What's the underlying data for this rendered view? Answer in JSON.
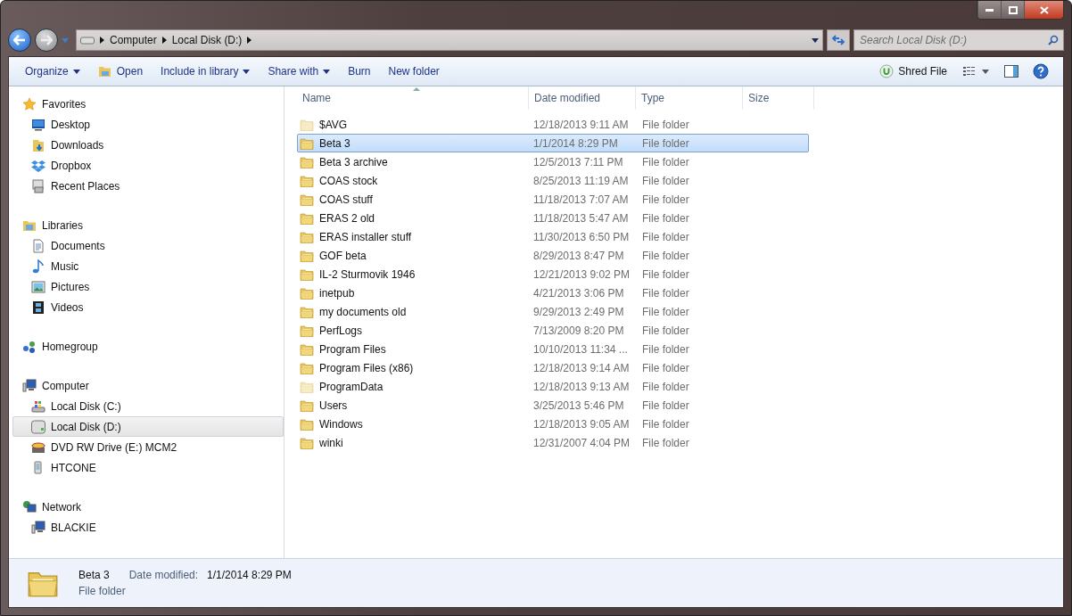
{
  "address": {
    "crumbs": [
      "Computer",
      "Local Disk (D:)"
    ]
  },
  "search": {
    "placeholder": "Search Local Disk (D:)"
  },
  "toolbar": {
    "left": [
      {
        "label": "Organize",
        "kind": "menu"
      },
      {
        "label": "Open",
        "kind": "open"
      },
      {
        "label": "Include in library",
        "kind": "menu"
      },
      {
        "label": "Share with",
        "kind": "menu"
      },
      {
        "label": "Burn",
        "kind": "plain"
      },
      {
        "label": "New folder",
        "kind": "plain"
      }
    ],
    "shred": {
      "label": "Shred File"
    }
  },
  "sidebar": {
    "groups": [
      {
        "label": "Favorites",
        "kind": "star",
        "selected": false,
        "children": [
          {
            "label": "Desktop",
            "kind": "desktop",
            "selected": false
          },
          {
            "label": "Downloads",
            "kind": "downloads",
            "selected": false
          },
          {
            "label": "Dropbox",
            "kind": "dropbox",
            "selected": false
          },
          {
            "label": "Recent Places",
            "kind": "recent",
            "selected": false
          }
        ]
      },
      {
        "label": "Libraries",
        "kind": "library",
        "selected": false,
        "children": [
          {
            "label": "Documents",
            "kind": "document",
            "selected": false
          },
          {
            "label": "Music",
            "kind": "music",
            "selected": false
          },
          {
            "label": "Pictures",
            "kind": "picture",
            "selected": false
          },
          {
            "label": "Videos",
            "kind": "video",
            "selected": false
          }
        ]
      },
      {
        "label": "Homegroup",
        "kind": "homegroup",
        "selected": false
      },
      {
        "label": "Computer",
        "kind": "computer",
        "selected": false,
        "children": [
          {
            "label": "Local Disk (C:)",
            "kind": "windrive",
            "selected": false
          },
          {
            "label": "Local Disk (D:)",
            "kind": "drive",
            "selected": true
          },
          {
            "label": "DVD RW Drive (E:) MCM2",
            "kind": "dvd",
            "selected": false
          },
          {
            "label": "HTCONE",
            "kind": "phone",
            "selected": false
          }
        ]
      },
      {
        "label": "Network",
        "kind": "network",
        "selected": false,
        "children": [
          {
            "label": "BLACKIE",
            "kind": "computer",
            "selected": false
          }
        ]
      }
    ]
  },
  "table": {
    "columns": [
      {
        "label": "Name",
        "sorted": true
      },
      {
        "label": "Date modified",
        "sorted": false
      },
      {
        "label": "Type",
        "sorted": false
      },
      {
        "label": "Size",
        "sorted": false
      }
    ],
    "rows": [
      {
        "name": "$AVG",
        "date": "12/18/2013 9:11 AM",
        "type": "File folder",
        "selected": false,
        "hidden": true
      },
      {
        "name": "Beta 3",
        "date": "1/1/2014 8:29 PM",
        "type": "File folder",
        "selected": true,
        "hidden": false
      },
      {
        "name": "Beta 3 archive",
        "date": "12/5/2013 7:11 PM",
        "type": "File folder",
        "selected": false,
        "hidden": false
      },
      {
        "name": "COAS stock",
        "date": "8/25/2013 11:19 AM",
        "type": "File folder",
        "selected": false,
        "hidden": false
      },
      {
        "name": "COAS stuff",
        "date": "11/18/2013 7:07 AM",
        "type": "File folder",
        "selected": false,
        "hidden": false
      },
      {
        "name": "ERAS 2 old",
        "date": "11/18/2013 5:47 AM",
        "type": "File folder",
        "selected": false,
        "hidden": false
      },
      {
        "name": "ERAS installer stuff",
        "date": "11/30/2013 6:50 PM",
        "type": "File folder",
        "selected": false,
        "hidden": false
      },
      {
        "name": "GOF beta",
        "date": "8/29/2013 8:47 PM",
        "type": "File folder",
        "selected": false,
        "hidden": false
      },
      {
        "name": "IL-2 Sturmovik 1946",
        "date": "12/21/2013 9:02 PM",
        "type": "File folder",
        "selected": false,
        "hidden": false
      },
      {
        "name": "inetpub",
        "date": "4/21/2013 3:06 PM",
        "type": "File folder",
        "selected": false,
        "hidden": false
      },
      {
        "name": "my documents old",
        "date": "9/29/2013 2:49 PM",
        "type": "File folder",
        "selected": false,
        "hidden": false
      },
      {
        "name": "PerfLogs",
        "date": "7/13/2009 8:20 PM",
        "type": "File folder",
        "selected": false,
        "hidden": false
      },
      {
        "name": "Program Files",
        "date": "10/10/2013 11:34 ...",
        "type": "File folder",
        "selected": false,
        "hidden": false
      },
      {
        "name": "Program Files (x86)",
        "date": "12/18/2013 9:14 AM",
        "type": "File folder",
        "selected": false,
        "hidden": false
      },
      {
        "name": "ProgramData",
        "date": "12/18/2013 9:13 AM",
        "type": "File folder",
        "selected": false,
        "hidden": true
      },
      {
        "name": "Users",
        "date": "3/25/2013 5:46 PM",
        "type": "File folder",
        "selected": false,
        "hidden": false
      },
      {
        "name": "Windows",
        "date": "12/18/2013 9:05 AM",
        "type": "File folder",
        "selected": false,
        "hidden": false
      },
      {
        "name": "winki",
        "date": "12/31/2007 4:04 PM",
        "type": "File folder",
        "selected": false,
        "hidden": false
      }
    ]
  },
  "details": {
    "name": "Beta 3",
    "date_label": "Date modified:",
    "date": "1/1/2014 8:29 PM",
    "type": "File folder"
  }
}
